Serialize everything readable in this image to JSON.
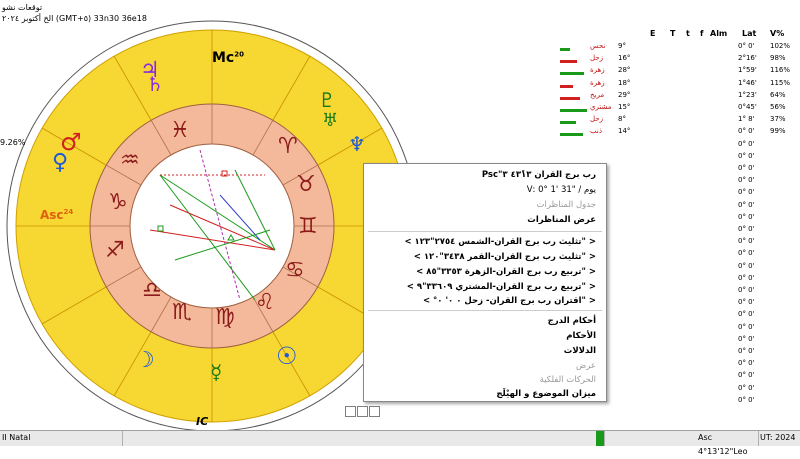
{
  "header": {
    "top_left_line1": "توقعات نشو",
    "top_left_line2": "الخ أكتوبر ٢٠٢٤ (GMT+٥) 33n30 36e18"
  },
  "chart": {
    "mc_label": "Mc",
    "mc_degree": "20",
    "asc_label": "Asc",
    "asc_degree": "24",
    "ic_label": "IC",
    "left_percent": "9.26%",
    "planets": [
      {
        "name": "jupiter",
        "glyph": "♃",
        "color": "#8a2be2"
      },
      {
        "name": "saturn",
        "glyph": "♄",
        "color": "#8a2be2"
      },
      {
        "name": "mars",
        "glyph": "♂",
        "color": "#d02020"
      },
      {
        "name": "venus",
        "glyph": "♀",
        "color": "#1a7a1a"
      },
      {
        "name": "mercury",
        "glyph": "☿",
        "color": "#1a7a1a"
      },
      {
        "name": "moon",
        "glyph": "☽",
        "color": "#1e5ad8"
      },
      {
        "name": "sun",
        "glyph": "☉",
        "color": "#1e5ad8"
      },
      {
        "name": "neptune",
        "glyph": "♆",
        "color": "#1e5ad8"
      },
      {
        "name": "pluto",
        "glyph": "♇",
        "color": "#1a7a1a"
      },
      {
        "name": "uranus",
        "glyph": "♅",
        "color": "#1a7a1a"
      }
    ],
    "zodiac_signs": [
      "♈",
      "♉",
      "♊",
      "♋",
      "♌",
      "♍",
      "♎",
      "♏",
      "♐",
      "♑",
      "♒",
      "♓"
    ]
  },
  "table": {
    "headers": [
      "E",
      "T",
      "t",
      "f",
      "Alm",
      "Lat",
      "V%"
    ],
    "rows": [
      {
        "planet": "نحس",
        "pos": "9°",
        "lat": "0° 0'",
        "v": "102%"
      },
      {
        "planet": "زحل",
        "pos": "16°",
        "lat": "2°16'",
        "v": "98%"
      },
      {
        "planet": "زهرة",
        "pos": "28°",
        "lat": "1°59'",
        "v": "116%"
      },
      {
        "planet": "زهرة",
        "pos": "18°",
        "lat": "1°46'",
        "v": "115%"
      },
      {
        "planet": "مريخ",
        "pos": "29°",
        "lat": "1°23'",
        "v": "64%"
      },
      {
        "planet": "مشتري",
        "pos": "15°",
        "lat": "0°45'",
        "v": "56%"
      },
      {
        "planet": "زحل",
        "pos": "8°",
        "lat": "1° 8'",
        "v": "37%"
      },
      {
        "planet": "ذنب",
        "pos": "14°",
        "lat": "0° 0'",
        "v": "99%"
      },
      {
        "planet": "",
        "pos": "",
        "lat": "0° 0'",
        "v": ""
      },
      {
        "planet": "",
        "pos": "",
        "lat": "0° 0'",
        "v": ""
      },
      {
        "planet": "",
        "pos": "",
        "lat": "0° 0'",
        "v": ""
      },
      {
        "planet": "",
        "pos": "",
        "lat": "0° 0'",
        "v": ""
      },
      {
        "planet": "",
        "pos": "",
        "lat": "0° 0'",
        "v": ""
      },
      {
        "planet": "",
        "pos": "",
        "lat": "0° 0'",
        "v": ""
      },
      {
        "planet": "",
        "pos": "",
        "lat": "0° 0'",
        "v": ""
      },
      {
        "planet": "",
        "pos": "",
        "lat": "0° 0'",
        "v": ""
      },
      {
        "planet": "",
        "pos": "",
        "lat": "0° 0'",
        "v": ""
      },
      {
        "planet": "",
        "pos": "",
        "lat": "0° 0'",
        "v": ""
      },
      {
        "planet": "",
        "pos": "",
        "lat": "0° 0'",
        "v": ""
      },
      {
        "planet": "",
        "pos": "",
        "lat": "0° 0'",
        "v": ""
      },
      {
        "planet": "",
        "pos": "",
        "lat": "0° 0'",
        "v": ""
      },
      {
        "planet": "",
        "pos": "",
        "lat": "0° 0'",
        "v": ""
      },
      {
        "planet": "",
        "pos": "",
        "lat": "0° 0'",
        "v": ""
      },
      {
        "planet": "",
        "pos": "",
        "lat": "0° 0'",
        "v": ""
      },
      {
        "planet": "",
        "pos": "",
        "lat": "0° 0'",
        "v": ""
      },
      {
        "planet": "",
        "pos": "",
        "lat": "0° 0'",
        "v": ""
      },
      {
        "planet": "",
        "pos": "",
        "lat": "0° 0'",
        "v": ""
      },
      {
        "planet": "",
        "pos": "",
        "lat": "0° 0'",
        "v": ""
      },
      {
        "planet": "",
        "pos": "",
        "lat": "0° 0'",
        "v": ""
      },
      {
        "planet": "",
        "pos": "",
        "lat": "0° 0'",
        "v": ""
      }
    ]
  },
  "context_menu": {
    "item_psc": "رب برج القران ٤٣ً١٣ ٣\"Psc",
    "item_day": "يوم / \"31 '1 °0 :V",
    "item_aspects_table": "جدول المناظرات",
    "item_show_aspects": "عرض المناظرات",
    "item_trine_sun": "< \"تثليث رب برج القران-الشمس ٢٧٥٤\"١٢٣ >",
    "item_trine_moon": "< \"تثليث رب برج القران-القمر ٣٤٣٨\"١٢٠ >",
    "item_square_venus": "< \"تربيع رب برج القران-الزهرة ٣٣٥٣\"٨٥ >",
    "item_square_jupiter": "< \"تربيع رب برج القران-المشتري ٣٣٦٠٩\"٩ >",
    "item_conj_saturn": "< \"اقتران رب برج القران- زحل ٠ ٠' ٠° >",
    "item_rulings": "أحكام الدرج",
    "item_judgments": "الأحكام",
    "item_signs": "الدلالات",
    "item_display": "عرض",
    "item_motions": "الحركات الفلكية",
    "item_balance": "ميزان الموضوع و الهيْلَج"
  },
  "bottom_bar": {
    "left_tab": "II Natal",
    "asc_readout": "Asc 4°13'12\"Leo",
    "ut_readout": "UT: 2024"
  },
  "colors": {
    "outer_ring": "#f7d731",
    "zodiac_band": "#f4b89a",
    "inner_circle": "#ffffff",
    "menu_border": "#888888"
  }
}
